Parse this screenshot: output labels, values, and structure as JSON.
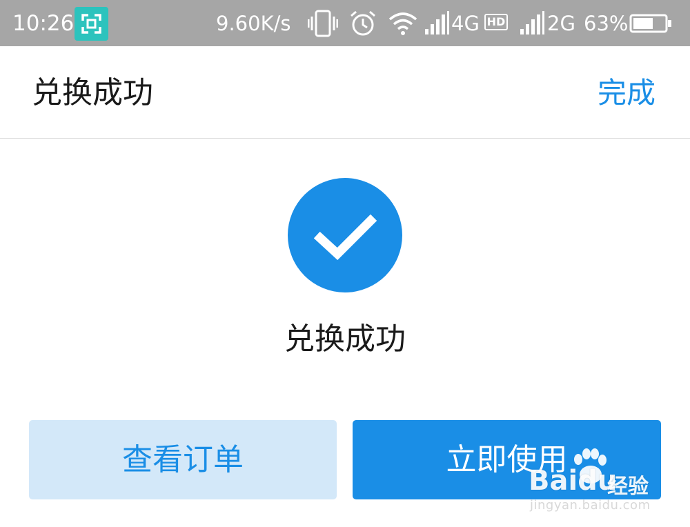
{
  "status_bar": {
    "time": "10:26",
    "net_speed": "9.60K/s",
    "network_1": "4G",
    "hd_badge": "HD",
    "network_2": "2G",
    "battery_percent": "63%",
    "battery_level": 0.63,
    "icons": [
      "screenshot-icon",
      "vibrate-icon",
      "alarm-icon",
      "wifi-icon",
      "signal-icon",
      "battery-icon"
    ]
  },
  "header": {
    "title": "兑换成功",
    "done_label": "完成"
  },
  "main": {
    "success_icon": "check-circle-icon",
    "success_text": "兑换成功"
  },
  "actions": {
    "view_order_label": "查看订单",
    "use_now_label": "立即使用"
  },
  "watermark": {
    "brand": "Bai",
    "brand_suffix": "du",
    "text": "经验",
    "url": "jingyan.baidu.com"
  },
  "colors": {
    "accent": "#1a8ee6",
    "status_bar_bg": "#a6a6a6",
    "light_button_bg": "#d3e8f9",
    "screenshot_badge": "#2cc3bd"
  }
}
